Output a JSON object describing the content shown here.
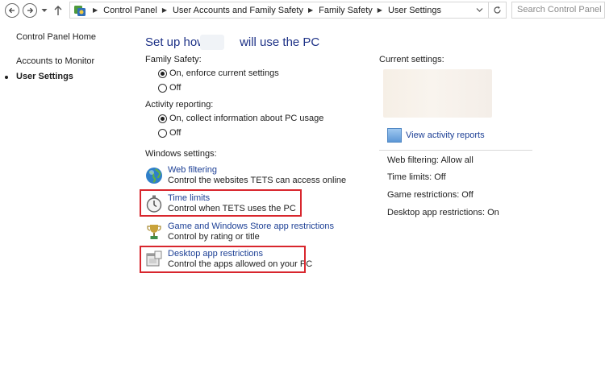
{
  "address_bar": {
    "breadcrumbs": [
      "Control Panel",
      "User Accounts and Family Safety",
      "Family Safety",
      "User Settings"
    ],
    "search_placeholder": "Search Control Panel",
    "icons": [
      "back-arrow-icon",
      "forward-arrow-icon",
      "recent-locations-icon",
      "up-arrow-icon",
      "control-panel-icon",
      "dropdown-chevron-icon",
      "refresh-icon"
    ]
  },
  "sidebar": {
    "items": [
      {
        "label": "Control Panel Home"
      },
      {
        "label": "Accounts to Monitor"
      },
      {
        "label": "User Settings",
        "selected": true
      }
    ]
  },
  "main": {
    "title_part1": "Set up how",
    "title_part2": "will use the PC",
    "family_safety": {
      "label": "Family Safety:",
      "options": [
        {
          "label": "On, enforce current settings",
          "checked": true
        },
        {
          "label": "Off",
          "checked": false
        }
      ]
    },
    "activity_reporting": {
      "label": "Activity reporting:",
      "options": [
        {
          "label": "On, collect information about PC usage",
          "checked": true
        },
        {
          "label": "Off",
          "checked": false
        }
      ]
    },
    "windows_settings": {
      "label": "Windows settings:",
      "items": [
        {
          "link": "Web filtering",
          "desc": "Control the websites TETS can access online",
          "icon": "globe-icon",
          "highlighted": false
        },
        {
          "link": "Time limits",
          "desc": "Control when TETS uses the PC",
          "icon": "stopwatch-icon",
          "highlighted": true
        },
        {
          "link": "Game and Windows Store app restrictions",
          "desc": "Control by rating or title",
          "icon": "trophy-icon",
          "highlighted": false
        },
        {
          "link": "Desktop app restrictions",
          "desc": "Control the apps allowed on your PC",
          "icon": "desktop-app-icon",
          "highlighted": true
        }
      ]
    }
  },
  "current_settings": {
    "label": "Current settings:",
    "report_link": "View activity reports",
    "items": [
      "Web filtering: Allow all",
      "Time limits: Off",
      "Game restrictions: Off",
      "Desktop app restrictions: On"
    ]
  },
  "colors": {
    "link": "#1c3f95",
    "title": "#1e3287",
    "highlight_border": "#d8262d"
  }
}
